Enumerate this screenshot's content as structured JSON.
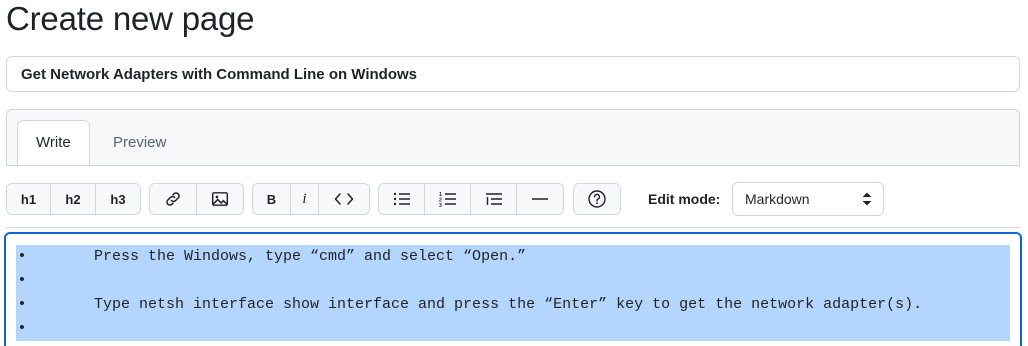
{
  "page": {
    "title": "Create new page"
  },
  "title_input": {
    "value": "Get Network Adapters with Command Line on Windows"
  },
  "tabs": [
    {
      "label": "Write",
      "active": true
    },
    {
      "label": "Preview",
      "active": false
    }
  ],
  "toolbar": {
    "headings": [
      "h1",
      "h2",
      "h3"
    ],
    "bold_label": "B",
    "italic_label": "i",
    "icons": {
      "link": "link-icon",
      "image": "image-icon",
      "code": "code-icon",
      "unordered_list": "unordered-list-icon",
      "ordered_list": "ordered-list-icon",
      "task_list": "task-list-icon",
      "horizontal_rule": "horizontal-rule-icon",
      "help": "question-icon"
    },
    "edit_mode_label": "Edit mode:",
    "edit_mode_value": "Markdown"
  },
  "editor": {
    "lines": [
      {
        "bullet": "•",
        "text": "Press the Windows, type “cmd” and select “Open.”"
      },
      {
        "bullet": "•",
        "text": ""
      },
      {
        "bullet": "•",
        "text": "Type netsh interface show interface and press the “Enter” key to get the network adapter(s)."
      },
      {
        "bullet": "•",
        "text": ""
      }
    ]
  },
  "colors": {
    "accent": "#0969da",
    "selection": "#b4d5fe",
    "border": "#d0d7de",
    "toolbar_bg": "#f6f8fa"
  }
}
